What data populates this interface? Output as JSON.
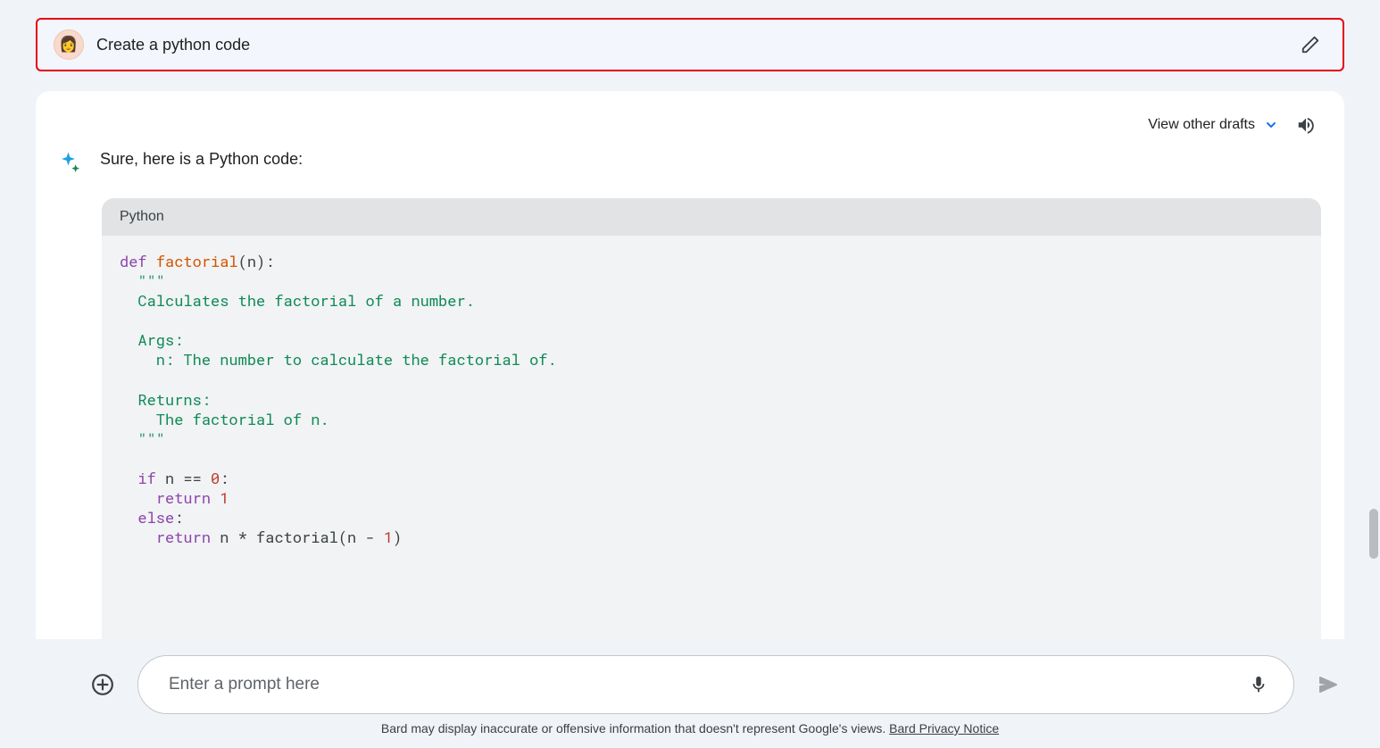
{
  "user": {
    "prompt": "Create a python code"
  },
  "drafts": {
    "label": "View other drafts"
  },
  "response": {
    "intro": "Sure, here is a Python code:",
    "code_lang": "Python",
    "code": {
      "l1a": "def",
      "l1b": " ",
      "l1c": "factorial",
      "l1d": "(n):",
      "l2": "  \"\"\"",
      "l3": "  Calculates the factorial of a number.",
      "l4": "",
      "l5": "  Args:",
      "l6": "    n: The number to calculate the factorial of.",
      "l7": "",
      "l8": "  Returns:",
      "l9": "    The factorial of n.",
      "l10": "  \"\"\"",
      "l11": "",
      "l12a": "  ",
      "l12b": "if",
      "l12c": " n == ",
      "l12d": "0",
      "l12e": ":",
      "l13a": "    ",
      "l13b": "return",
      "l13c": " ",
      "l13d": "1",
      "l14a": "  ",
      "l14b": "else",
      "l14c": ":",
      "l15a": "    ",
      "l15b": "return",
      "l15c": " n * factorial(n - ",
      "l15d": "1",
      "l15e": ")"
    }
  },
  "input": {
    "placeholder": "Enter a prompt here"
  },
  "disclaimer": {
    "text": "Bard may display inaccurate or offensive information that doesn't represent Google's views. ",
    "link": "Bard Privacy Notice"
  }
}
